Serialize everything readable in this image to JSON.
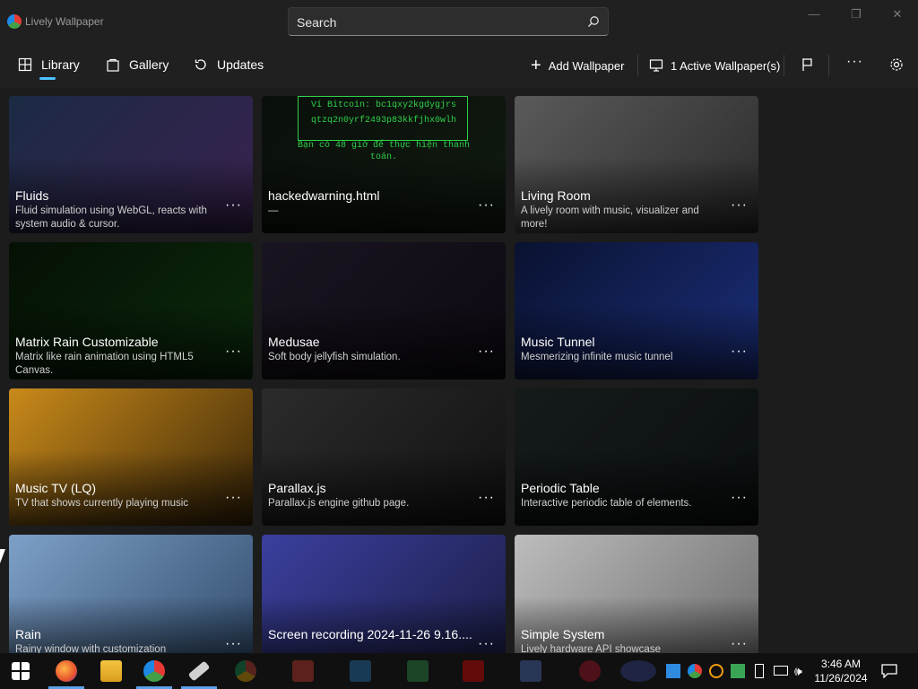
{
  "app": {
    "title": "Lively Wallpaper"
  },
  "search": {
    "placeholder": "Search"
  },
  "nav": {
    "tabs": [
      {
        "label": "Library",
        "icon": "grid-icon",
        "selected": true
      },
      {
        "label": "Gallery",
        "icon": "bag-icon"
      },
      {
        "label": "Updates",
        "icon": "refresh-icon"
      }
    ],
    "add_wallpaper": "Add Wallpaper",
    "active_wallpapers": "1 Active Wallpaper(s)"
  },
  "wallpapers": [
    {
      "title": "Fluids",
      "desc": "Fluid simulation using WebGL, reacts with system audio & cursor.",
      "colors": [
        "#1b2a44",
        "#3a2250"
      ]
    },
    {
      "title": "hackedwarning.html",
      "desc": "—",
      "colors": [
        "#0a0f0a",
        "#101a10"
      ],
      "thumb_text": [
        "Ví Bitcoin: bc1qxy2kgdygjrs",
        "qtzq2n0yrf2493p83kkfjhx0wlh",
        "Bạn có 48 giờ để thực hiện thanh",
        "toán."
      ]
    },
    {
      "title": "Living Room",
      "desc": "A lively room with music, visualizer and more!",
      "colors": [
        "#5a5a5a",
        "#2a2a2a"
      ]
    },
    {
      "title": "Matrix Rain Customizable",
      "desc": "Matrix like rain animation using HTML5 Canvas.",
      "colors": [
        "#051005",
        "#0b2a0b"
      ]
    },
    {
      "title": "Medusae",
      "desc": "Soft body jellyfish simulation.",
      "colors": [
        "#1a1420",
        "#0d0a12"
      ]
    },
    {
      "title": "Music Tunnel",
      "desc": "Mesmerizing infinite music tunnel",
      "colors": [
        "#0a1230",
        "#1b2e7a"
      ]
    },
    {
      "title": "Music TV (LQ)",
      "desc": "TV that shows currently playing music",
      "colors": [
        "#c98a1a",
        "#3a2608"
      ]
    },
    {
      "title": "Parallax.js",
      "desc": "Parallax.js engine github page.",
      "colors": [
        "#2b2b2b",
        "#121212"
      ]
    },
    {
      "title": "Periodic Table",
      "desc": "Interactive periodic table of elements.",
      "colors": [
        "#151a1a",
        "#0b0f0f"
      ]
    },
    {
      "title": "Rain",
      "desc": "Rainy window with customization",
      "colors": [
        "#7ea0c8",
        "#2f4a6a"
      ]
    },
    {
      "title": "Screen recording 2024-11-26 9.16....",
      "desc": "",
      "colors": [
        "#3b3f9e",
        "#1b1d44"
      ]
    },
    {
      "title": "Simple System",
      "desc": "Lively hardware API showcase",
      "colors": [
        "#bdbdbd",
        "#6a6a6a"
      ]
    }
  ],
  "taskbar": {
    "icons": [
      "windows-start-icon",
      "firefox-icon",
      "file-explorer-icon",
      "lively-icon",
      "usb-drive-icon",
      "chrome-icon",
      "gmail-icon",
      "store-icon",
      "play-store-icon",
      "youtube-icon",
      "photos-icon",
      "opera-icon",
      "app-icon"
    ],
    "time": "3:46 AM",
    "date": "11/26/2024"
  },
  "colors": {
    "accent": "#4cc2ff",
    "background": "#1c1c1c",
    "chrome": "#202020"
  }
}
